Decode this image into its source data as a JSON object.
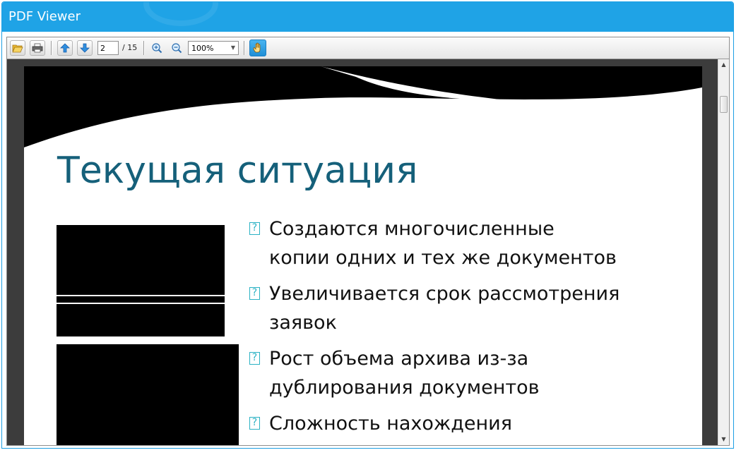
{
  "window": {
    "title": "PDF Viewer"
  },
  "toolbar": {
    "open_icon": "folder-open-icon",
    "print_icon": "printer-icon",
    "prev_icon": "arrow-up-icon",
    "next_icon": "arrow-down-icon",
    "current_page": "2",
    "total_pages": "/ 15",
    "zoom_in_icon": "zoom-in-icon",
    "zoom_out_icon": "zoom-out-icon",
    "zoom_value": "100%",
    "pan_icon": "hand-icon",
    "accent_color": "#1fa3e6"
  },
  "slide": {
    "title": "Текущая ситуация",
    "bullet_marker": "?",
    "bullets": [
      {
        "line1": "Создаются многочисленные",
        "line2": "копии одних и тех же документов"
      },
      {
        "line1": "Увеличивается срок рассмотрения",
        "line2": "заявок"
      },
      {
        "line1": "Рост объема архива из-за",
        "line2": "дублирования документов"
      },
      {
        "line1": "Сложность нахождения",
        "line2": ""
      }
    ],
    "title_color": "#15607a",
    "bullet_color": "#2bb2c4"
  }
}
